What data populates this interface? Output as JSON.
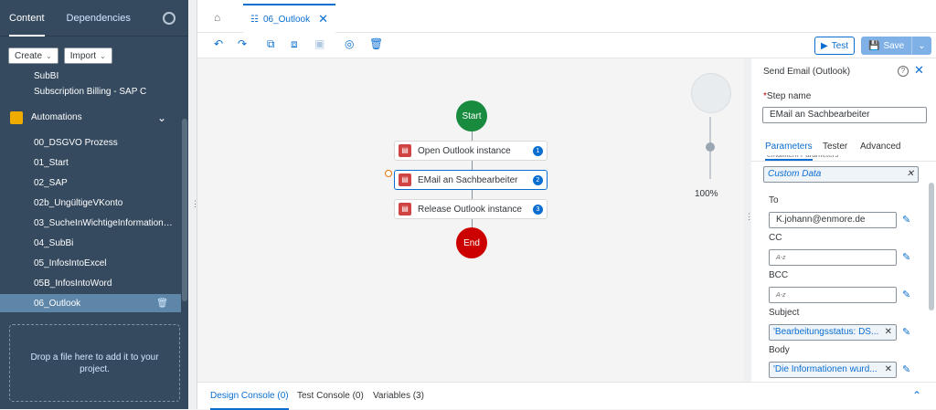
{
  "sidebar": {
    "tabs": [
      "Content",
      "Dependencies"
    ],
    "create_label": "Create",
    "import_label": "Import",
    "items_top": [
      "SubBI",
      "Subscription Billing - SAP C"
    ],
    "group_label": "Automations",
    "items": [
      "00_DSGVO Prozess",
      "01_Start",
      "02_SAP",
      "02b_UngültigeVKonto",
      "03_SucheInWichtigeInformationen...",
      "04_SubBi",
      "05_InfosIntoExcel",
      "05B_InfosIntoWord",
      "06_Outlook"
    ],
    "dropzone_text": "Drop a file here to add it to your project."
  },
  "editor": {
    "tab_label": "06_Outlook",
    "test_label": "Test",
    "save_label": "Save"
  },
  "flow": {
    "start_label": "Start",
    "end_label": "End",
    "steps": [
      {
        "label": "Open Outlook instance",
        "num": "1"
      },
      {
        "label": "EMail an Sachbearbeiter",
        "num": "2"
      },
      {
        "label": "Release Outlook instance",
        "num": "3"
      }
    ],
    "zoom": "100%"
  },
  "console": {
    "tabs": [
      "Design Console (0)",
      "Test Console (0)",
      "Variables (3)"
    ]
  },
  "details": {
    "title": "Send Email (Outlook)",
    "step_name_label": "Step name",
    "step_name_value": "EMail an Sachbearbeiter",
    "tabs": [
      "Parameters",
      "Tester",
      "Advanced"
    ],
    "cut_label": "emailItem Parameters",
    "custom_data": "Custom Data",
    "to_label": "To",
    "to_value": "K.johann@enmore.de",
    "cc_label": "CC",
    "bcc_label": "BCC",
    "placeholder": "A-z",
    "subject_label": "Subject",
    "subject_value": "'Bearbeitungsstatus: DS...",
    "body_label": "Body",
    "body_value": "'Die Informationen wurd..."
  },
  "colors": {
    "accent": "#0a6ed1",
    "sidebar_bg": "#354a5f",
    "start": "#188b3f",
    "end": "#cc0000"
  }
}
